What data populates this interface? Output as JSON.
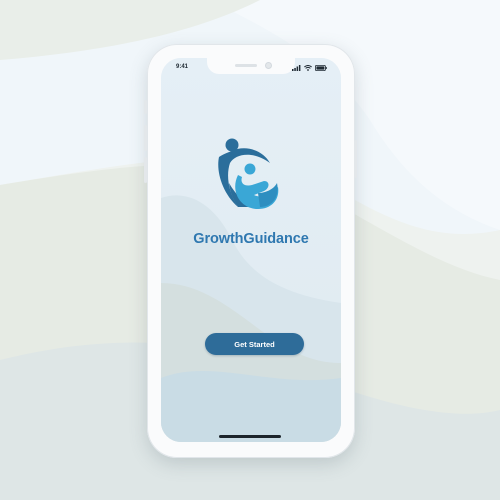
{
  "status_bar": {
    "time": "9:41",
    "icons": [
      "signal-icon",
      "wifi-icon",
      "battery-icon"
    ]
  },
  "app": {
    "name": "GrowthGuidance",
    "logo_icon": "people-g-logo-icon"
  },
  "actions": {
    "primary_label": "Get Started"
  },
  "colors": {
    "brand_blue": "#2f78b0",
    "button_blue": "#2e6c99",
    "logo_dark": "#2b6e9b",
    "logo_light": "#3aa7d6"
  }
}
